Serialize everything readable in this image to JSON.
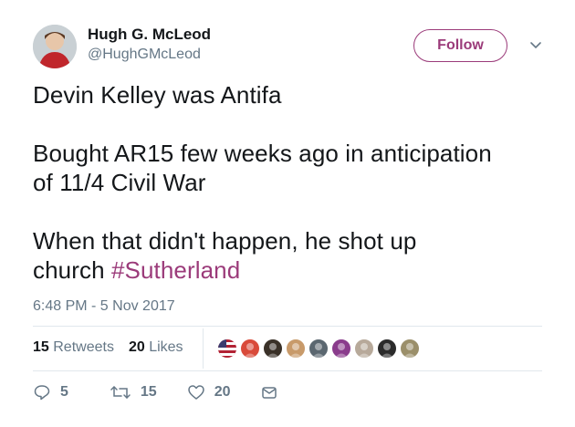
{
  "author": {
    "name": "Hugh G. McLeod",
    "handle": "@HughGMcLeod",
    "avatar_icon": "user-avatar"
  },
  "follow_button": {
    "label": "Follow",
    "color": "#9b3b7a"
  },
  "tweet": {
    "line1": "Devin Kelley was Antifa",
    "line2": "Bought AR15 few weeks ago in anticipation",
    "line3": "of 11/4 Civil War",
    "line4": "When that didn't happen, he shot up",
    "line5_prefix": "church ",
    "hashtag": "#Sutherland",
    "timestamp": "6:48 PM - 5 Nov 2017"
  },
  "stats": {
    "retweets_count": "15",
    "retweets_label": "Retweets",
    "likes_count": "20",
    "likes_label": "Likes"
  },
  "likers": [
    {
      "icon": "flag-avatar",
      "color": "#b22234"
    },
    {
      "icon": "avatar",
      "color": "#d94a3a"
    },
    {
      "icon": "avatar",
      "color": "#3a3128"
    },
    {
      "icon": "avatar",
      "color": "#c89a6a"
    },
    {
      "icon": "avatar",
      "color": "#5b6770"
    },
    {
      "icon": "avatar",
      "color": "#8a3c8c"
    },
    {
      "icon": "avatar",
      "color": "#b7a99a"
    },
    {
      "icon": "avatar",
      "color": "#2b2b2b"
    },
    {
      "icon": "avatar",
      "color": "#9b8f6a"
    }
  ],
  "actions": {
    "reply_count": "5",
    "retweet_count": "15",
    "like_count": "20"
  }
}
